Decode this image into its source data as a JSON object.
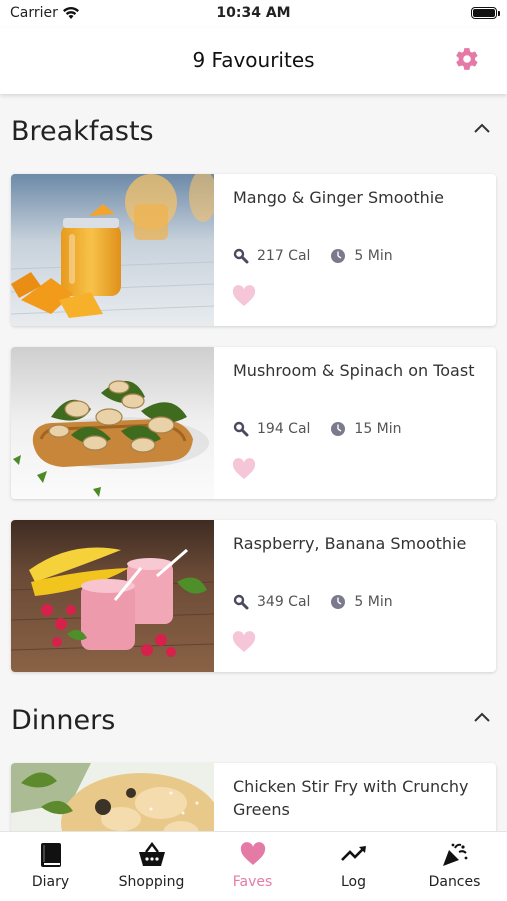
{
  "status_bar": {
    "carrier": "Carrier",
    "time": "10:34 AM"
  },
  "header": {
    "title": "9 Favourites",
    "settings_icon": "gear-icon"
  },
  "colors": {
    "accent": "#e57aa6",
    "heart": "#f5c6d7"
  },
  "sections": [
    {
      "title": "Breakfasts",
      "recipes": [
        {
          "name": "Mango & Ginger Smoothie",
          "calories": "217 Cal",
          "time": "5 Min"
        },
        {
          "name": "Mushroom & Spinach on Toast",
          "calories": "194 Cal",
          "time": "15 Min"
        },
        {
          "name": "Raspberry, Banana Smoothie",
          "calories": "349 Cal",
          "time": "5 Min"
        }
      ]
    },
    {
      "title": "Dinners",
      "recipes": [
        {
          "name": "Chicken Stir Fry with Crunchy Greens"
        }
      ]
    }
  ],
  "tabs": [
    {
      "label": "Diary",
      "icon": "book-icon"
    },
    {
      "label": "Shopping",
      "icon": "basket-icon"
    },
    {
      "label": "Faves",
      "icon": "heart-icon",
      "active": true
    },
    {
      "label": "Log",
      "icon": "trend-icon"
    },
    {
      "label": "Dances",
      "icon": "party-popper-icon"
    }
  ]
}
